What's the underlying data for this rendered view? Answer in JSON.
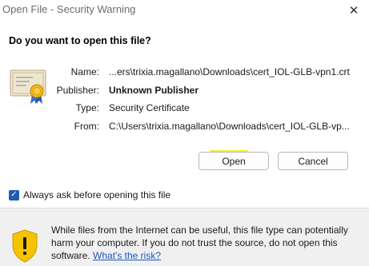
{
  "window": {
    "title": "Open File - Security Warning",
    "close_glyph": "✕"
  },
  "dialog": {
    "question": "Do you want to open this file?",
    "fields": {
      "name_label": "Name:",
      "name_value": "...ers\\trixia.magallano\\Downloads\\cert_IOL-GLB-vpn1.crt",
      "publisher_label": "Publisher:",
      "publisher_value": "Unknown Publisher",
      "type_label": "Type:",
      "type_value": "Security Certificate",
      "from_label": "From:",
      "from_value": "C:\\Users\\trixia.magallano\\Downloads\\cert_IOL-GLB-vp..."
    },
    "buttons": {
      "open": "Open",
      "cancel": "Cancel"
    },
    "checkbox": {
      "label": "Always ask before opening this file",
      "checked": true
    },
    "warning": {
      "text": "While files from the Internet can be useful, this file type can potentially harm your computer. If you do not trust the source, do not open this software.",
      "link": "What's the risk?"
    }
  },
  "icons": {
    "certificate": "certificate-icon",
    "shield": "warning-shield-icon",
    "close": "close-icon"
  },
  "colors": {
    "highlight": "#f4ef28",
    "checkbox_accent": "#1f5bb7",
    "link": "#1a57c4",
    "shield_yellow": "#f5c400"
  }
}
